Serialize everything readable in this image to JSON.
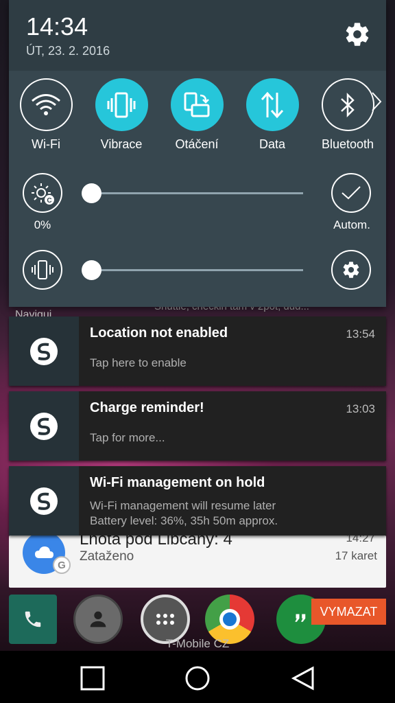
{
  "status": {
    "time": "14:34",
    "date": "ÚT, 23. 2. 2016"
  },
  "quick_tiles": [
    {
      "label": "Wi-Fi",
      "state": "off",
      "icon": "wifi-icon"
    },
    {
      "label": "Vibrace",
      "state": "on",
      "icon": "vibrate-icon"
    },
    {
      "label": "Otáčení",
      "state": "on",
      "icon": "rotate-icon"
    },
    {
      "label": "Data",
      "state": "on",
      "icon": "data-icon"
    },
    {
      "label": "Bluetooth",
      "state": "off",
      "icon": "bluetooth-icon"
    }
  ],
  "brightness": {
    "percent_label": "0%",
    "value": 0,
    "auto_label": "Autom."
  },
  "volume": {
    "value": 0
  },
  "notifications": [
    {
      "title": "Location not enabled",
      "time": "13:54",
      "text": "Tap here to enable"
    },
    {
      "title": "Charge reminder!",
      "time": "13:03",
      "text": "Tap for more..."
    },
    {
      "title": "Wi-Fi management on hold",
      "time": "",
      "text_line1": "Wi-Fi management will resume later",
      "text_line2": "Battery level: 36%, 35h 50m approx."
    }
  ],
  "background": {
    "weather_title": "Lhota pod Libčany: 4",
    "weather_sub": "Zataženo",
    "weather_count": "17 karet",
    "weather_time": "14:27",
    "clear_button": "VYMAZAT",
    "carrier": "T-Mobile CZ",
    "behind_label": "Navigui",
    "behind_snippet": "Shuttle, checkin tam v 2pot, dud..."
  },
  "colors": {
    "accent": "#26c6da",
    "panel": "#37474f",
    "clear_button": "#e8572a"
  }
}
